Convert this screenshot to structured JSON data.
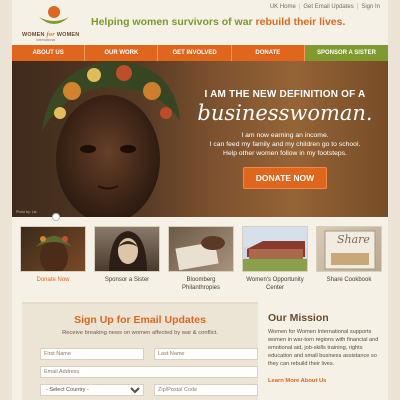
{
  "brand": {
    "logo_text_1": "WOMEN",
    "logo_text_for": "for",
    "logo_text_2": "WOMEN",
    "logo_sub": "International",
    "tagline_main": "Helping women survivors of war",
    "tagline_highlight": "rebuild their lives.",
    "color_orange": "#e0661d",
    "color_green": "#7f9a2e"
  },
  "toplinks": [
    "UK Home",
    "Get Email Updates",
    "Sign In"
  ],
  "nav": [
    "ABOUT US",
    "OUR WORK",
    "GET INVOLVED",
    "DONATE",
    "SPONSOR A SISTER"
  ],
  "hero": {
    "headline": "I AM THE NEW DEFINITION OF A",
    "headline_big": "businesswoman.",
    "lines": [
      "I am now earning an income.",
      "I can feed my family and my children go to school.",
      "Help other women follow in my footsteps."
    ],
    "donate_label": "DONATE NOW",
    "photo_credit": "Photo by: Lia"
  },
  "thumbs": [
    {
      "label": "Donate Now",
      "active": true
    },
    {
      "label": "Sponsor a Sister",
      "active": false
    },
    {
      "label": "Bloomberg Philanthropies",
      "active": false
    },
    {
      "label": "Women's Opportunity Center",
      "active": false
    },
    {
      "label": "Share Cookbook",
      "active": false
    }
  ],
  "thumb_overlay_text": "Share",
  "signup": {
    "title": "Sign Up for Email Updates",
    "subtitle": "Receive breaking news on women affected by war & conflict.",
    "first_name_placeholder": "First Name",
    "last_name_placeholder": "Last Name",
    "email_placeholder": "Email Address",
    "country_selected": "- Select Country -",
    "zip_placeholder": "Zip/Postal Code"
  },
  "mission": {
    "title": "Our Mission",
    "body": "Women for Women International supports women in war-torn regions with financial and emotional aid, job-skills training, rights education and small business assistance so they can rebuild their lives.",
    "link": "Learn More About Us"
  }
}
